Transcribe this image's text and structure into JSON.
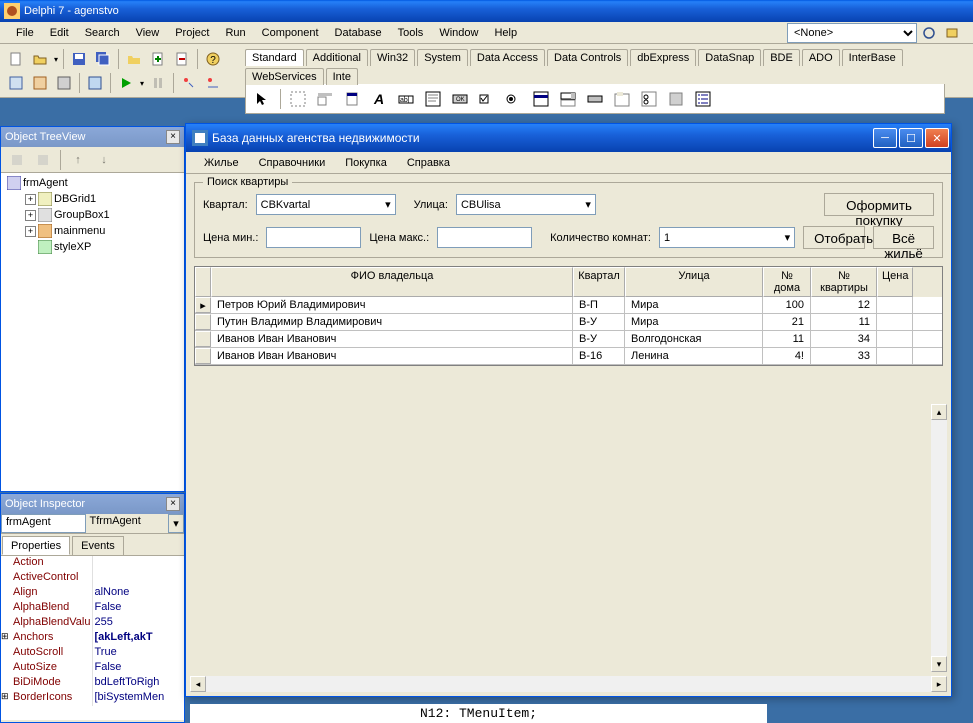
{
  "ide": {
    "title": "Delphi 7 - agenstvo",
    "menu": [
      "File",
      "Edit",
      "Search",
      "View",
      "Project",
      "Run",
      "Component",
      "Database",
      "Tools",
      "Window",
      "Help"
    ],
    "combo_none": "<None>",
    "palette_tabs": [
      "Standard",
      "Additional",
      "Win32",
      "System",
      "Data Access",
      "Data Controls",
      "dbExpress",
      "DataSnap",
      "BDE",
      "ADO",
      "InterBase",
      "WebServices",
      "Inte"
    ]
  },
  "tree": {
    "title": "Object TreeView",
    "root": "frmAgent",
    "children": [
      "DBGrid1",
      "GroupBox1",
      "mainmenu",
      "styleXP"
    ]
  },
  "inspector": {
    "title": "Object Inspector",
    "object_name": "frmAgent",
    "object_type": "TfrmAgent",
    "tabs": [
      "Properties",
      "Events"
    ],
    "props": [
      {
        "name": "Action",
        "value": "",
        "exp": false
      },
      {
        "name": "ActiveControl",
        "value": "",
        "exp": false
      },
      {
        "name": "Align",
        "value": "alNone",
        "exp": false
      },
      {
        "name": "AlphaBlend",
        "value": "False",
        "exp": false
      },
      {
        "name": "AlphaBlendValu",
        "value": "255",
        "exp": false
      },
      {
        "name": "Anchors",
        "value": "[akLeft,akT",
        "exp": true
      },
      {
        "name": "AutoScroll",
        "value": "True",
        "exp": false
      },
      {
        "name": "AutoSize",
        "value": "False",
        "exp": false
      },
      {
        "name": "BiDiMode",
        "value": "bdLeftToRigh",
        "exp": false
      },
      {
        "name": "BorderIcons",
        "value": "[biSystemMen",
        "exp": true
      }
    ]
  },
  "app": {
    "title": "База данных агенства недвижимости",
    "menu": [
      "Жилье",
      "Справочники",
      "Покупка",
      "Справка"
    ],
    "groupbox_title": "Поиск квартиры",
    "labels": {
      "kvartal": "Квартал:",
      "ulitsa": "Улица:",
      "price_min": "Цена мин.:",
      "price_max": "Цена макс.:",
      "rooms": "Количество комнат:"
    },
    "combos": {
      "kvartal": "CBKvartal",
      "ulitsa": "CBUlisa",
      "rooms": "1"
    },
    "buttons": {
      "arrange": "Оформить покупку",
      "filter": "Отобрать",
      "all": "Всё жильё"
    },
    "grid_headers": [
      "ФИО владельца",
      "Квартал",
      "Улица",
      "№ дома",
      "№ квартиры",
      "Цена"
    ],
    "rows": [
      {
        "fio": "Петров Юрий Владимирович",
        "kv": "В-П",
        "ul": "Мира",
        "dom": "100",
        "kvn": "12",
        "price": ""
      },
      {
        "fio": "Путин Владимир Владимирович",
        "kv": "В-У",
        "ul": "Мира",
        "dom": "21",
        "kvn": "11",
        "price": ""
      },
      {
        "fio": "Иванов Иван Иванович",
        "kv": "В-У",
        "ul": "Волгодонская",
        "dom": "11",
        "kvn": "34",
        "price": ""
      },
      {
        "fio": "Иванов Иван Иванович",
        "kv": "В-16",
        "ul": "Ленина",
        "dom": "4!",
        "kvn": "33",
        "price": ""
      }
    ]
  },
  "code_line": "N12: TMenuItem;"
}
